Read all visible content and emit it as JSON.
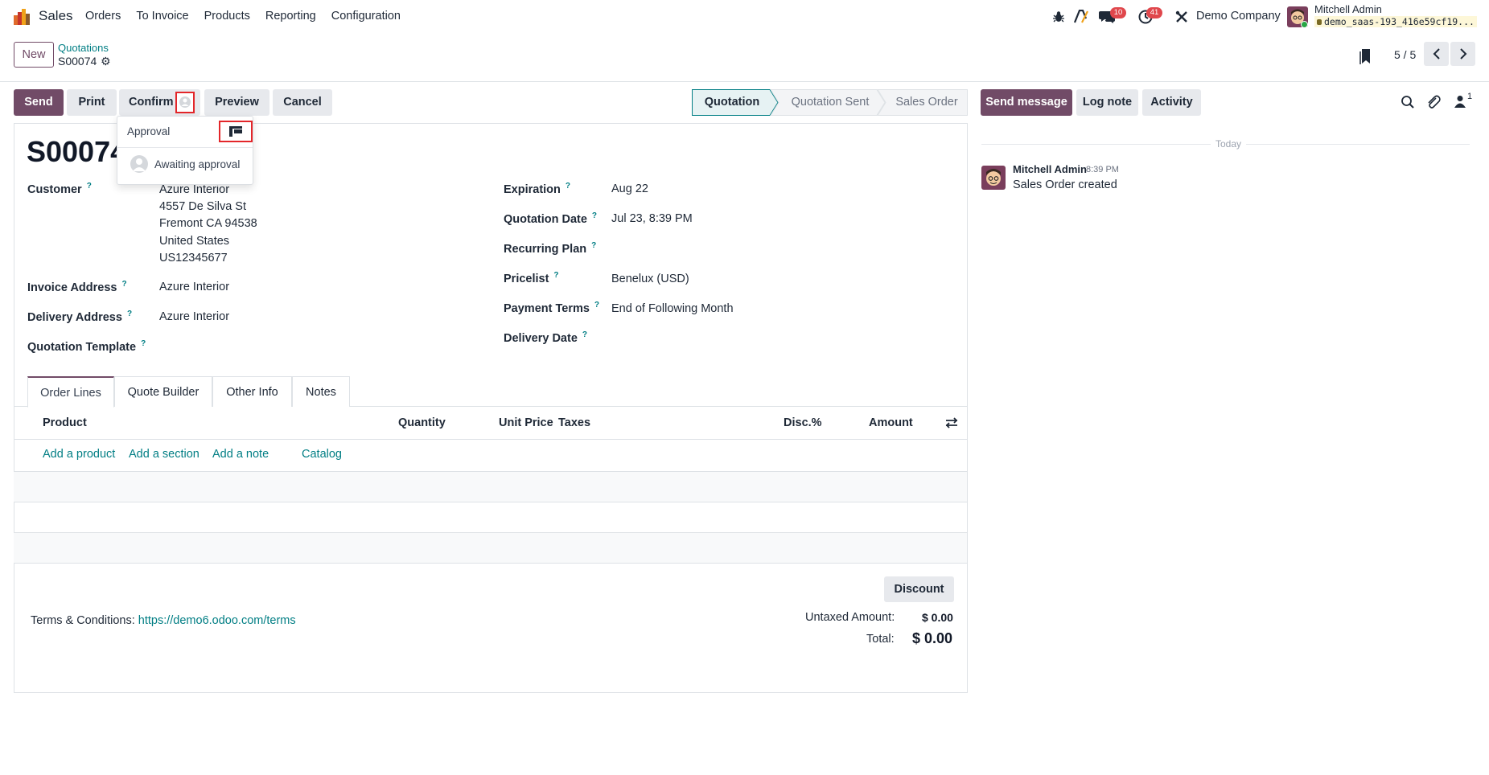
{
  "navbar": {
    "app_name": "Sales",
    "menu": [
      "Orders",
      "To Invoice",
      "Products",
      "Reporting",
      "Configuration"
    ],
    "messages_badge": "10",
    "activities_badge": "41",
    "company": "Demo Company",
    "user_name": "Mitchell Admin",
    "db_name": "demo_saas-193_416e59cf19..."
  },
  "control_panel": {
    "new_label": "New",
    "breadcrumb_parent": "Quotations",
    "breadcrumb_current": "S00074",
    "pager": "5 / 5"
  },
  "actions": {
    "send": "Send",
    "print": "Print",
    "confirm": "Confirm",
    "preview": "Preview",
    "cancel": "Cancel"
  },
  "statusbar": {
    "steps": [
      "Quotation",
      "Quotation Sent",
      "Sales Order"
    ],
    "active": "Quotation"
  },
  "approval_dropdown": {
    "title": "Approval",
    "item": "Awaiting approval"
  },
  "form": {
    "record_name": "S00074",
    "left_fields": {
      "customer_label": "Customer",
      "customer_lines": [
        "Azure Interior",
        "4557 De Silva St",
        "Fremont CA 94538",
        "United States",
        "US12345677"
      ],
      "invoice_label": "Invoice Address",
      "invoice_value": "Azure Interior",
      "delivery_label": "Delivery Address",
      "delivery_value": "Azure Interior",
      "template_label": "Quotation Template",
      "template_value": ""
    },
    "right_fields": {
      "expiration_label": "Expiration",
      "expiration_value": "Aug 22",
      "qdate_label": "Quotation Date",
      "qdate_value": "Jul 23, 8:39 PM",
      "recurring_label": "Recurring Plan",
      "recurring_value": "",
      "pricelist_label": "Pricelist",
      "pricelist_value": "Benelux (USD)",
      "terms_label": "Payment Terms",
      "terms_value": "End of Following Month",
      "ddate_label": "Delivery Date",
      "ddate_value": ""
    },
    "help_mark": "?",
    "tabs": [
      "Order Lines",
      "Quote Builder",
      "Other Info",
      "Notes"
    ],
    "table_headers": [
      "Product",
      "Quantity",
      "Unit Price",
      "Taxes",
      "Disc.%",
      "Amount"
    ],
    "add_links": [
      "Add a product",
      "Add a section",
      "Add a note",
      "Catalog"
    ],
    "discount_label": "Discount",
    "terms_text": "Terms & Conditions:",
    "terms_url": "https://demo6.odoo.com/terms",
    "untaxed_label": "Untaxed Amount:",
    "untaxed_value": "$ 0.00",
    "total_label": "Total:",
    "total_value": "$ 0.00"
  },
  "chatter": {
    "send_message": "Send message",
    "log_note": "Log note",
    "activity": "Activity",
    "followers_count": "1",
    "today": "Today",
    "message": {
      "author": "Mitchell Admin",
      "time": "8:39 PM",
      "body": "Sales Order created"
    }
  },
  "colors": {
    "brand": "#714b67",
    "link": "#017e84",
    "badge": "#e0474c",
    "highlight": "#e3262a"
  },
  "icons": [
    "app-logo-icon",
    "bug-icon",
    "ai-icon",
    "chat-icon",
    "clock-icon",
    "tools-icon",
    "gear-icon",
    "bookmark-icon",
    "chevron-left-icon",
    "chevron-right-icon",
    "kanban-icon",
    "column-settings-icon",
    "search-icon",
    "paperclip-icon",
    "follower-icon"
  ]
}
